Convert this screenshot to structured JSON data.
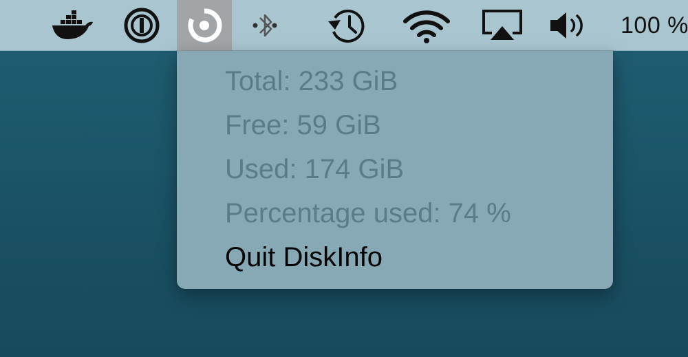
{
  "menubar": {
    "icons": [
      {
        "name": "docker-icon"
      },
      {
        "name": "1password-icon"
      },
      {
        "name": "diskinfo-icon",
        "active": true
      },
      {
        "name": "bluetooth-icon"
      },
      {
        "name": "time-machine-icon"
      },
      {
        "name": "wifi-icon"
      },
      {
        "name": "airplay-icon"
      },
      {
        "name": "volume-icon"
      }
    ],
    "battery_text": "100 %"
  },
  "menu": {
    "items": [
      {
        "label": "Total: 233 GiB",
        "enabled": false
      },
      {
        "label": "Free: 59 GiB",
        "enabled": false
      },
      {
        "label": "Used: 174 GiB",
        "enabled": false
      },
      {
        "label": "Percentage used: 74 %",
        "enabled": false
      },
      {
        "label": "Quit DiskInfo",
        "enabled": true
      }
    ]
  },
  "colors": {
    "menubar_bg": "#a9c6d0",
    "menu_bg": "#86a9b5",
    "active_icon_bg": "#a2a5a7",
    "desktop_bg": "#1c5468",
    "disabled_text": "#5a7c89",
    "enabled_text": "#050505"
  }
}
